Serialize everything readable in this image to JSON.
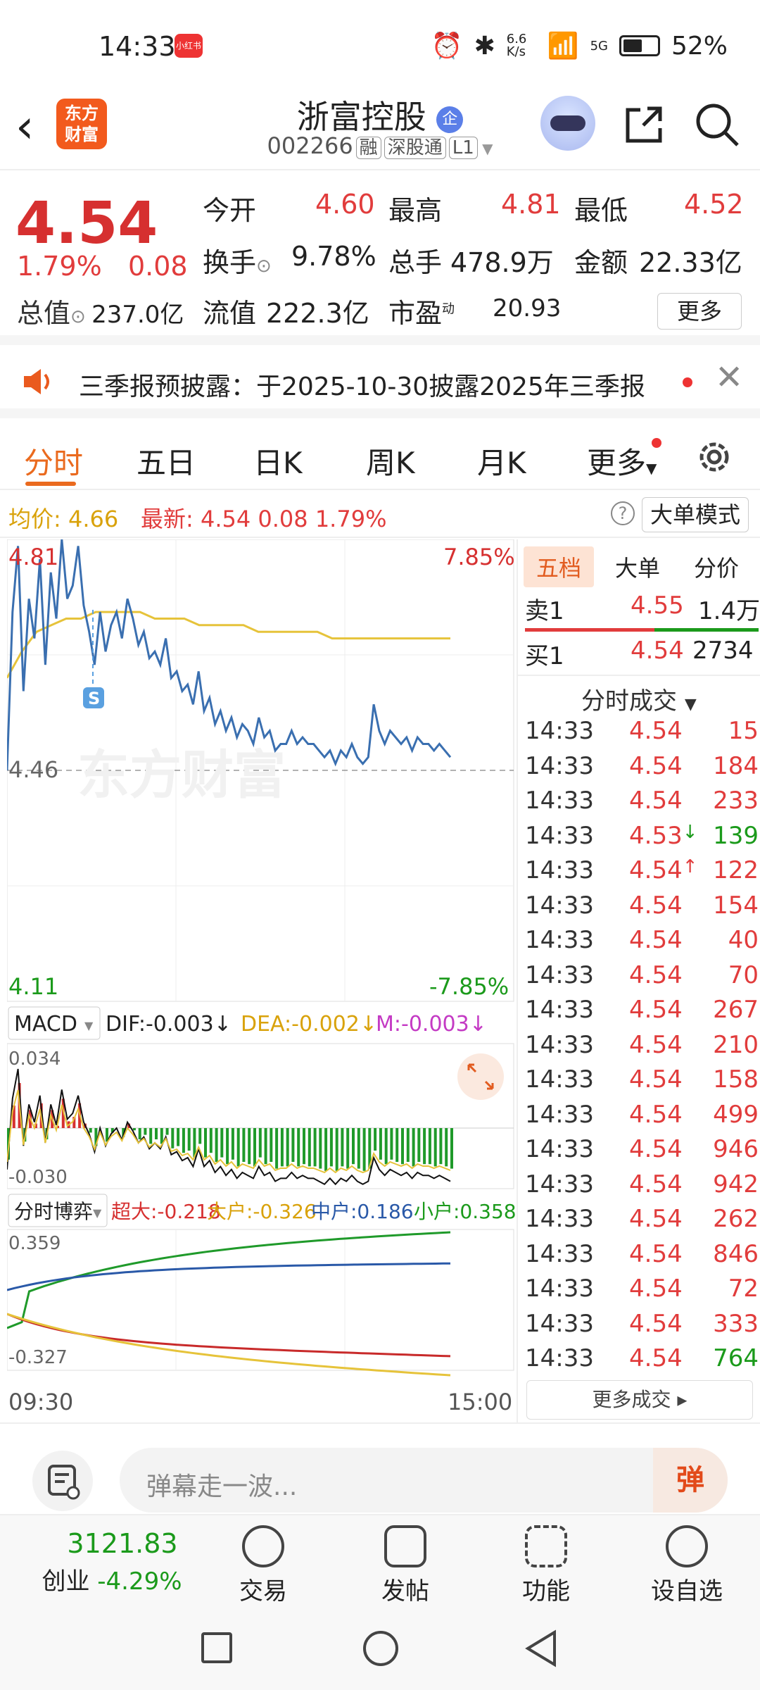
{
  "status_bar": {
    "time": "14:33",
    "app_badge": "小红书",
    "net_speed": "6.6\nK/s",
    "network": "5G",
    "battery": "52%"
  },
  "header": {
    "logo_line1": "东方",
    "logo_line2": "财富",
    "stock_name": "浙富控股",
    "qi_badge": "企",
    "code": "002266",
    "tags": [
      "融",
      "深股通",
      "L1"
    ]
  },
  "quote": {
    "price": "4.54",
    "pct": "1.79%",
    "change": "0.08",
    "open_label": "今开",
    "open": "4.60",
    "high_label": "最高",
    "high": "4.81",
    "low_label": "最低",
    "low": "4.52",
    "turnover_label": "换手",
    "turnover": "9.78%",
    "volume_label": "总手",
    "volume": "478.9万",
    "amount_label": "金额",
    "amount": "22.33亿",
    "mktcap_label": "总值",
    "mktcap": "237.0亿",
    "float_label": "流值",
    "float": "222.3亿",
    "pe_label": "市盈",
    "pe_sup": "动",
    "pe": "20.93",
    "more": "更多"
  },
  "notice": {
    "text": "三季报预披露：于2025-10-30披露2025年三季报"
  },
  "tabs": [
    "分时",
    "五日",
    "日K",
    "周K",
    "月K",
    "更多"
  ],
  "infobar": {
    "avg_label": "均价:",
    "avg": "4.66",
    "latest_label": "最新:",
    "latest": "4.54",
    "chg": "0.08",
    "pct": "1.79%",
    "big_mode": "大单模式"
  },
  "intraday": {
    "top_price": "4.81",
    "top_pct": "7.85%",
    "mid_price": "4.46",
    "bottom_price": "4.11",
    "bottom_pct": "-7.85%",
    "s_marker": "S",
    "watermark": "东方财富",
    "price_series": [
      4.46,
      4.7,
      4.8,
      4.58,
      4.72,
      4.66,
      4.78,
      4.62,
      4.76,
      4.69,
      4.81,
      4.72,
      4.74,
      4.8,
      4.71,
      4.67,
      4.62,
      4.7,
      4.64,
      4.68,
      4.7,
      4.66,
      4.72,
      4.69,
      4.65,
      4.67,
      4.63,
      4.64,
      4.62,
      4.66,
      4.6,
      4.61,
      4.58,
      4.59,
      4.56,
      4.61,
      4.55,
      4.57,
      4.53,
      4.55,
      4.52,
      4.54,
      4.51,
      4.53,
      4.52,
      4.5,
      4.54,
      4.51,
      4.52,
      4.49,
      4.5,
      4.5,
      4.52,
      4.5,
      4.51,
      4.5,
      4.5,
      4.49,
      4.48,
      4.49,
      4.47,
      4.49,
      4.48,
      4.5,
      4.48,
      4.47,
      4.48,
      4.56,
      4.52,
      4.5,
      4.52,
      4.51,
      4.5,
      4.51,
      4.49,
      4.51,
      4.5,
      4.5,
      4.49,
      4.5,
      4.49,
      4.48
    ],
    "avg_series": [
      4.6,
      4.64,
      4.67,
      4.68,
      4.69,
      4.69,
      4.7,
      4.7,
      4.7,
      4.7,
      4.69,
      4.69,
      4.69,
      4.68,
      4.68,
      4.68,
      4.68,
      4.67,
      4.67,
      4.67,
      4.67,
      4.67,
      4.66,
      4.66,
      4.66,
      4.66,
      4.66,
      4.66,
      4.66,
      4.66,
      4.66
    ]
  },
  "macd": {
    "label": "MACD",
    "dif": "DIF:-0.003↓",
    "dea": "DEA:-0.002↓",
    "m": "M:-0.003↓",
    "top": "0.034",
    "bottom": "-0.030"
  },
  "boyi": {
    "label": "分时博弈",
    "chaoda": "超大:-0.218",
    "dahu": "大户:-0.326",
    "zhonghu": "中户:0.186",
    "xiaohu": "小户:0.358",
    "top": "0.359",
    "bottom": "-0.327"
  },
  "time_axis": {
    "start": "09:30",
    "end": "15:00"
  },
  "ladder": {
    "tabs": [
      "五档",
      "大单",
      "分价"
    ],
    "sell1_label": "卖1",
    "sell1_price": "4.55",
    "sell1_vol": "1.4万",
    "buy1_label": "买1",
    "buy1_price": "4.54",
    "buy1_vol": "2734",
    "trades_header": "分时成交",
    "trades": [
      {
        "t": "14:33",
        "p": "4.54",
        "v": "15",
        "c": "red",
        "arrow": ""
      },
      {
        "t": "14:33",
        "p": "4.54",
        "v": "184",
        "c": "red",
        "arrow": ""
      },
      {
        "t": "14:33",
        "p": "4.54",
        "v": "233",
        "c": "red",
        "arrow": ""
      },
      {
        "t": "14:33",
        "p": "4.53",
        "v": "139",
        "c": "green",
        "arrow": "↓"
      },
      {
        "t": "14:33",
        "p": "4.54",
        "v": "122",
        "c": "red",
        "arrow": "↑"
      },
      {
        "t": "14:33",
        "p": "4.54",
        "v": "154",
        "c": "red",
        "arrow": ""
      },
      {
        "t": "14:33",
        "p": "4.54",
        "v": "40",
        "c": "red",
        "arrow": ""
      },
      {
        "t": "14:33",
        "p": "4.54",
        "v": "70",
        "c": "red",
        "arrow": ""
      },
      {
        "t": "14:33",
        "p": "4.54",
        "v": "267",
        "c": "red",
        "arrow": ""
      },
      {
        "t": "14:33",
        "p": "4.54",
        "v": "210",
        "c": "red",
        "arrow": ""
      },
      {
        "t": "14:33",
        "p": "4.54",
        "v": "158",
        "c": "red",
        "arrow": ""
      },
      {
        "t": "14:33",
        "p": "4.54",
        "v": "499",
        "c": "red",
        "arrow": ""
      },
      {
        "t": "14:33",
        "p": "4.54",
        "v": "946",
        "c": "red",
        "arrow": ""
      },
      {
        "t": "14:33",
        "p": "4.54",
        "v": "942",
        "c": "red",
        "arrow": ""
      },
      {
        "t": "14:33",
        "p": "4.54",
        "v": "262",
        "c": "red",
        "arrow": ""
      },
      {
        "t": "14:33",
        "p": "4.54",
        "v": "846",
        "c": "red",
        "arrow": ""
      },
      {
        "t": "14:33",
        "p": "4.54",
        "v": "72",
        "c": "red",
        "arrow": ""
      },
      {
        "t": "14:33",
        "p": "4.54",
        "v": "333",
        "c": "red",
        "arrow": ""
      },
      {
        "t": "14:33",
        "p": "4.54",
        "v": "764",
        "c": "green",
        "arrow": ""
      }
    ],
    "more_trades": "更多成交 ▸"
  },
  "comment": {
    "placeholder": "弹幕走一波...",
    "dan": "弹"
  },
  "bottom_nav": {
    "index_value": "3121.83",
    "index_name": "创业",
    "index_pct": "-4.29%",
    "items": [
      "交易",
      "发帖",
      "功能",
      "设自选"
    ]
  }
}
